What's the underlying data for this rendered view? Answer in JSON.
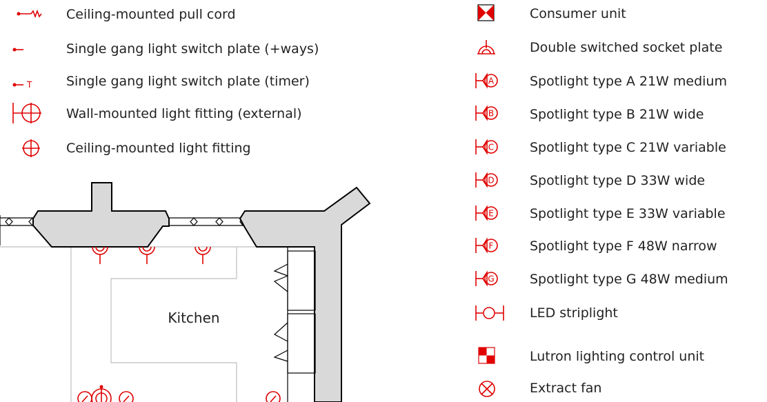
{
  "legend_left": [
    {
      "label": "Ceiling-mounted pull cord",
      "icon": "pull-cord-icon"
    },
    {
      "label": "Single gang light switch plate (+ways)",
      "icon": "switch-plate-icon"
    },
    {
      "label": "Single gang light switch plate (timer)",
      "icon": "timer-switch-icon"
    },
    {
      "label": "Wall-mounted light fitting (external)",
      "icon": "wall-light-icon"
    },
    {
      "label": "Ceiling-mounted light fitting",
      "icon": "ceiling-light-icon"
    }
  ],
  "legend_right": [
    {
      "label": "Consumer unit",
      "icon": "consumer-unit-icon"
    },
    {
      "label": "Double switched socket plate",
      "icon": "socket-plate-icon"
    },
    {
      "label": "Spotlight type A 21W medium",
      "icon": "spotlight-a-icon",
      "letter": "A"
    },
    {
      "label": "Spotlight type B 21W wide",
      "icon": "spotlight-b-icon",
      "letter": "B"
    },
    {
      "label": "Spotlight type C 21W variable",
      "icon": "spotlight-c-icon",
      "letter": "C"
    },
    {
      "label": "Spotlight type D 33W wide",
      "icon": "spotlight-d-icon",
      "letter": "D"
    },
    {
      "label": "Spotlight type E 33W variable",
      "icon": "spotlight-e-icon",
      "letter": "E"
    },
    {
      "label": "Spotlight type F 48W narrow",
      "icon": "spotlight-f-icon",
      "letter": "F"
    },
    {
      "label": "Spotlight type G 48W medium",
      "icon": "spotlight-g-icon",
      "letter": "G"
    },
    {
      "label": "LED striplight",
      "icon": "led-striplight-icon"
    },
    {
      "label": "Lutron lighting control unit",
      "icon": "lutron-unit-icon"
    },
    {
      "label": "Extract fan",
      "icon": "extract-fan-icon"
    }
  ],
  "plan": {
    "room_label": "Kitchen",
    "timer_letter": "T"
  },
  "colors": {
    "accent": "#e00000",
    "wall_fill": "#d9d9d9",
    "line": "#000000"
  }
}
